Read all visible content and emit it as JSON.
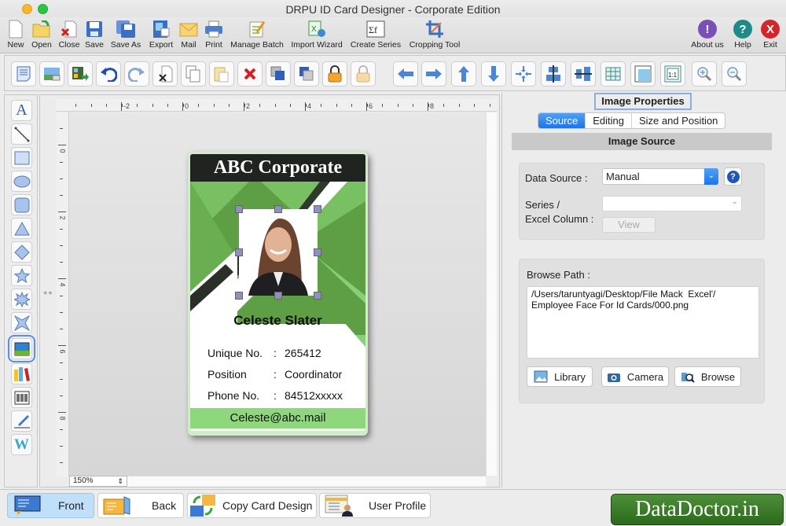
{
  "window": {
    "title": "DRPU ID Card Designer - Corporate Edition"
  },
  "main_toolbar": {
    "items": [
      {
        "label": "New",
        "icon": "new-document-icon"
      },
      {
        "label": "Open",
        "icon": "open-folder-icon"
      },
      {
        "label": "Close",
        "icon": "close-document-icon"
      },
      {
        "label": "Save",
        "icon": "save-icon"
      },
      {
        "label": "Save As",
        "icon": "save-as-icon"
      },
      {
        "label": "Export",
        "icon": "export-icon"
      },
      {
        "label": "Mail",
        "icon": "mail-icon"
      },
      {
        "label": "Print",
        "icon": "printer-icon"
      },
      {
        "label": "Manage Batch",
        "icon": "manage-batch-icon"
      },
      {
        "label": "Import Wizard",
        "icon": "import-wizard-icon"
      },
      {
        "label": "Create Series",
        "icon": "create-series-icon"
      },
      {
        "label": "Cropping Tool",
        "icon": "crop-icon"
      }
    ],
    "right_items": [
      {
        "label": "About us",
        "icon": "info-icon",
        "glyph": "!",
        "color": "#7b4fb8"
      },
      {
        "label": "Help",
        "icon": "help-icon",
        "glyph": "?",
        "color": "#1f8a8a"
      },
      {
        "label": "Exit",
        "icon": "exit-icon",
        "glyph": "X",
        "color": "#d2262b"
      }
    ]
  },
  "edit_toolbar": {
    "items": [
      "properties",
      "background",
      "insert-image",
      "undo",
      "redo",
      "cut",
      "copy",
      "paste",
      "delete",
      "bring-to-front",
      "send-to-back",
      "lock",
      "unlock",
      "move-left",
      "move-right",
      "move-up",
      "move-down",
      "center",
      "align-horizontal-center",
      "align-vertical-center",
      "grid",
      "ruler",
      "actual-size",
      "zoom-in",
      "zoom-out"
    ]
  },
  "drawing_tools": {
    "items": [
      "text",
      "line",
      "rectangle",
      "ellipse",
      "rounded-rectangle",
      "triangle",
      "diamond",
      "star",
      "burst",
      "four-point-star",
      "image",
      "library",
      "barcode",
      "signature",
      "watermark"
    ],
    "selected": "image"
  },
  "rulers": {
    "horizontal_labels": [
      "-2",
      "0",
      "2",
      "4",
      "6",
      "8"
    ],
    "vertical_labels": [
      "0",
      "2",
      "4",
      "6",
      "8"
    ]
  },
  "canvas": {
    "zoom": "150%"
  },
  "card": {
    "company": "ABC Corporate",
    "name": "Celeste Slater",
    "fields": [
      {
        "label": "Unique No.",
        "sep": ":",
        "value": "265412"
      },
      {
        "label": "Position",
        "sep": ":",
        "value": "Coordinator"
      },
      {
        "label": "Phone No.",
        "sep": ":",
        "value": "84512xxxxx"
      }
    ],
    "email": "Celeste@abc.mail",
    "colors": {
      "header": "#1f2420",
      "green": "#5e9e45",
      "light_green": "#86d07a",
      "footer": "#8fd77d"
    }
  },
  "properties": {
    "title": "Image Properties",
    "tabs": [
      {
        "label": "Source",
        "active": true
      },
      {
        "label": "Editing",
        "active": false
      },
      {
        "label": "Size and Position",
        "active": false
      }
    ],
    "section_title": "Image Source",
    "data_source_label": "Data Source :",
    "data_source_value": "Manual",
    "series_label_1": "Series /",
    "series_label_2": "Excel Column :",
    "series_value": "",
    "view_label": "View",
    "browse_path_label": "Browse Path :",
    "browse_path_value": "/Users/taruntyagi/Desktop/File Mack  Excel'/\nEmployee Face For Id Cards/000.png",
    "buttons": [
      {
        "label": "Library",
        "icon": "library-icon"
      },
      {
        "label": "Camera",
        "icon": "camera-icon"
      },
      {
        "label": "Browse",
        "icon": "browse-icon"
      }
    ]
  },
  "bottom_bar": {
    "items": [
      {
        "label": "Front",
        "active": true
      },
      {
        "label": "Back",
        "active": false
      },
      {
        "label": "Copy Card Design",
        "active": false
      },
      {
        "label": "User Profile",
        "active": false
      }
    ],
    "brand": "DataDoctor.in"
  }
}
